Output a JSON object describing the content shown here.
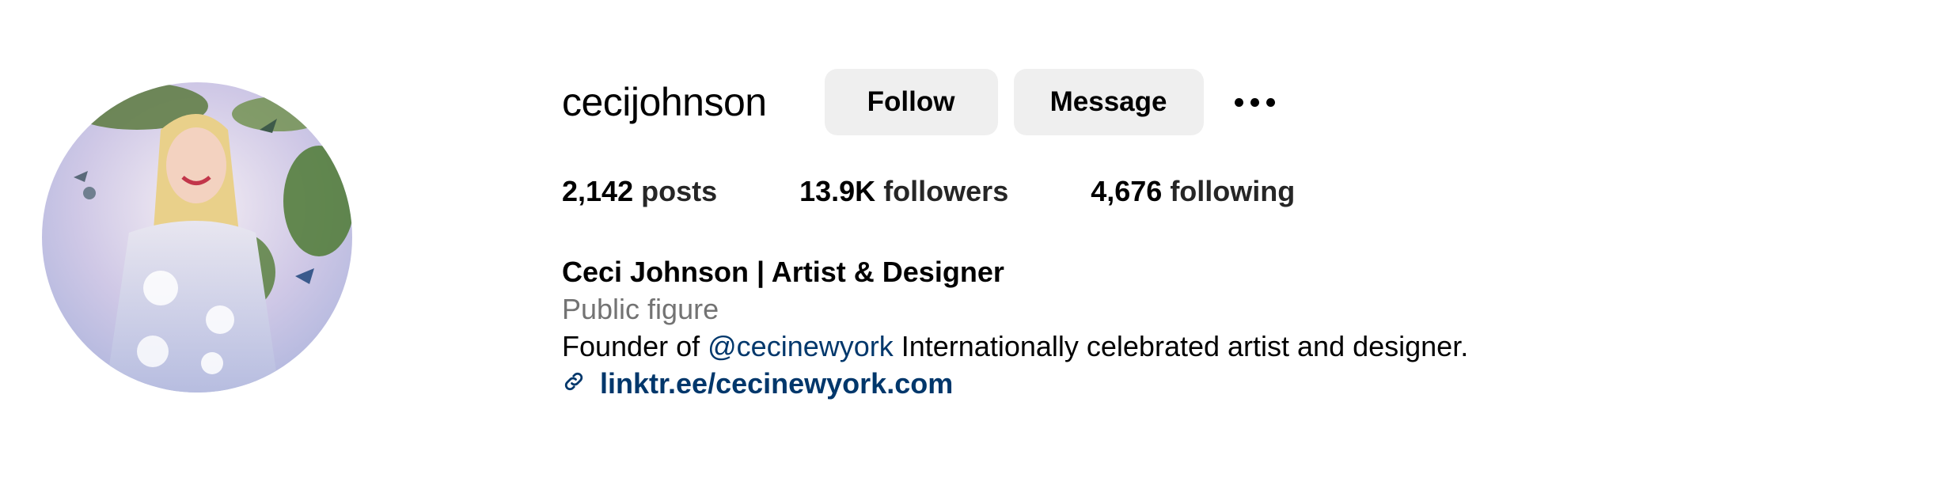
{
  "profile": {
    "username": "cecijohnson",
    "buttons": {
      "follow": "Follow",
      "message": "Message"
    },
    "more_icon": "more-horizontal-icon",
    "stats": {
      "posts_count": "2,142",
      "posts_label": "posts",
      "followers_count": "13.9K",
      "followers_label": "followers",
      "following_count": "4,676",
      "following_label": "following"
    },
    "bio": {
      "display_name": "Ceci Johnson | Artist & Designer",
      "category": "Public figure",
      "text_prefix": "Founder of ",
      "mention": "@cecinewyork",
      "text_suffix": " Internationally celebrated artist and designer.",
      "link_icon": "link-icon",
      "link": "linktr.ee/cecinewyork.com"
    }
  },
  "colors": {
    "button_bg": "#efefef",
    "link": "#00376b",
    "category": "#737373"
  }
}
